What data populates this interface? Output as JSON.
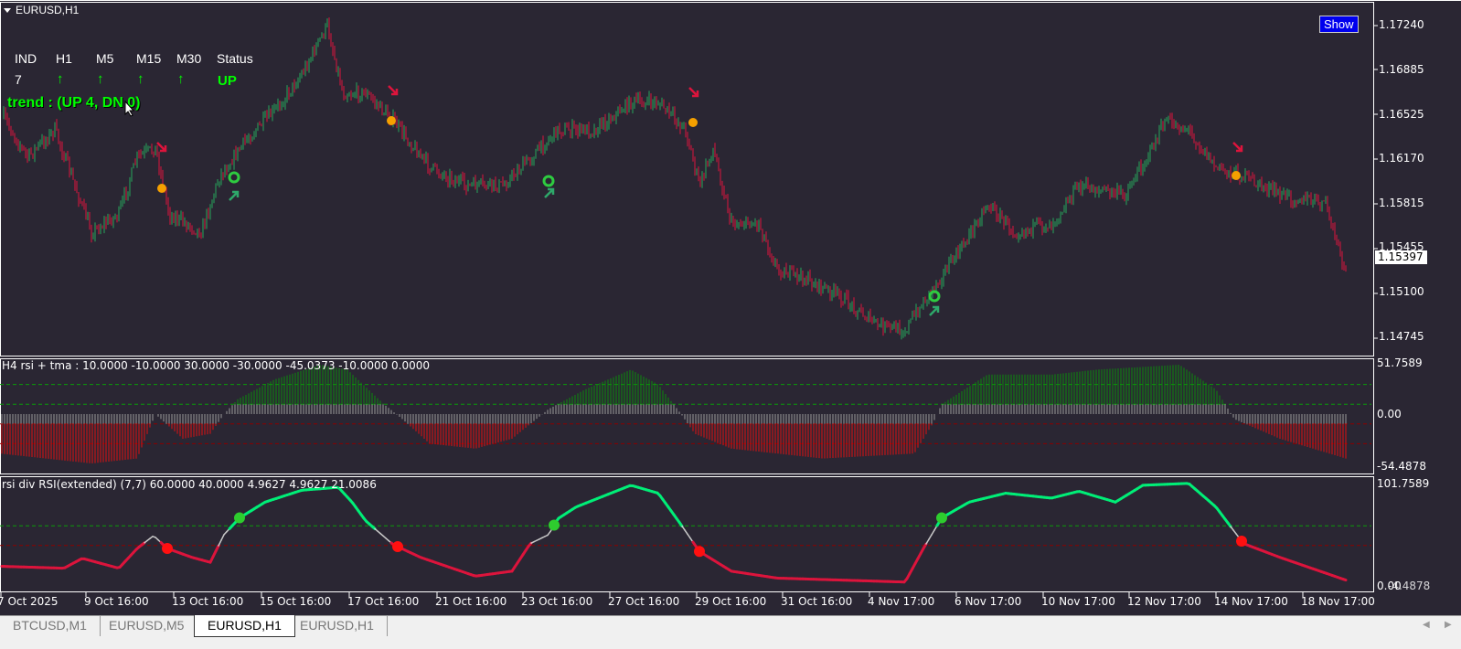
{
  "window": {
    "symbol_title": "EURUSD,H1"
  },
  "dashboard": {
    "headers": [
      "IND",
      "H1",
      "M5",
      "M15",
      "M30",
      "Status"
    ],
    "count": "7",
    "arrows": [
      "↑",
      "↑",
      "↑",
      "↑"
    ],
    "status": "UP",
    "trend": "trend : (UP 4, DN 0)"
  },
  "show_button": "Show",
  "price_axis": {
    "labels": [
      "1.17240",
      "1.16885",
      "1.16525",
      "1.16170",
      "1.15815",
      "1.15455",
      "1.15100",
      "1.14745"
    ],
    "current_price": "1.15397"
  },
  "indicator1": {
    "title": "H4 rsi + tma  :  10.0000 -10.0000 30.0000 -30.0000 -45.0373 -10.0000 0.0000",
    "axis": [
      "51.7589",
      "0.00",
      "-54.4878"
    ],
    "levels": [
      30,
      10,
      -10,
      -30
    ]
  },
  "indicator2": {
    "title": "rsi div RSI(extended) (7,7) 60.0000 40.0000 4.9627 4.9627 21.0086",
    "axis": [
      "101.7589",
      "0.00",
      "-4.4878"
    ],
    "levels": [
      60,
      40
    ]
  },
  "time_axis": [
    "7 Oct 2025",
    "9 Oct 16:00",
    "13 Oct 16:00",
    "15 Oct 16:00",
    "17 Oct 16:00",
    "21 Oct 16:00",
    "23 Oct 16:00",
    "27 Oct 16:00",
    "29 Oct 16:00",
    "31 Oct 16:00",
    "4 Nov 17:00",
    "6 Nov 17:00",
    "10 Nov 17:00",
    "12 Nov 17:00",
    "14 Nov 17:00",
    "18 Nov 17:00"
  ],
  "tabs": [
    "BTCUSD,M1",
    "EURUSD,M5",
    "EURUSD,H1",
    "EURUSD,H1"
  ],
  "active_tab": 2,
  "colors": {
    "background": "#2a2633",
    "bull": "#26a65b",
    "bear": "#dc143c",
    "rsi_up": "#00ee77",
    "rsi_down": "#dc143c",
    "show_button": "#0000ee"
  }
}
